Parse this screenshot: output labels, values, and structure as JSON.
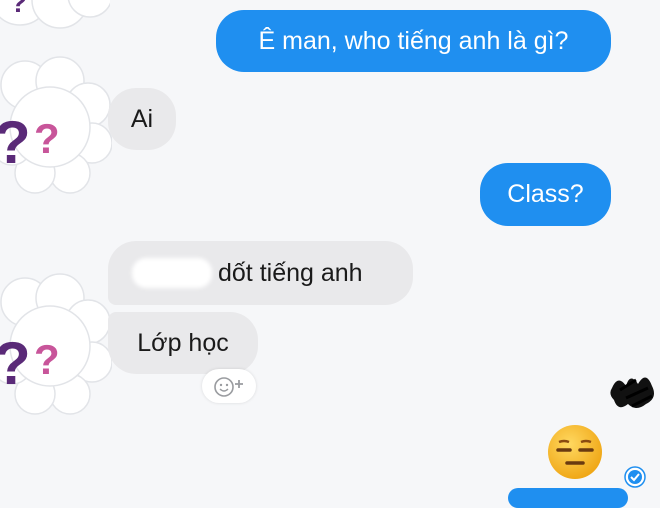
{
  "messages": {
    "m1_text": "Ê man, who tiếng anh là gì?",
    "m2_text": "Ai",
    "m3_text": "Class?",
    "m4_text": "dốt tiếng anh",
    "m5_text": "Lớp học"
  },
  "icons": {
    "avatar": "question-marks-cloud-avatar",
    "reaction": "add-reaction-icon",
    "emoji": "expressionless-face-emoji",
    "seen": "seen-checkmark-icon"
  },
  "colors": {
    "outgoing_bubble": "#1f8ff0",
    "incoming_bubble": "#e9e9eb",
    "background": "#f6f7f9",
    "question_purple": "#5a2a78",
    "question_pink": "#c8559a"
  }
}
